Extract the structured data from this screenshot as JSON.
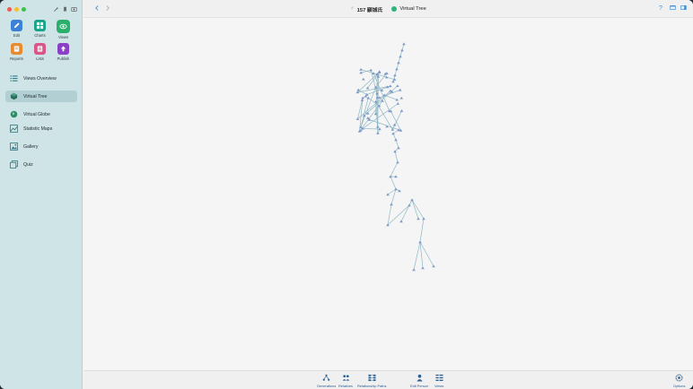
{
  "window": {
    "breadcrumb": {
      "person": "157 颛城氏",
      "view": "Virtual Tree"
    }
  },
  "sidebar": {
    "tools": [
      {
        "name": "edit",
        "label": "Edit",
        "color": "#3b82d6",
        "icon": "pencil-icon"
      },
      {
        "name": "charts",
        "label": "Charts",
        "color": "#17a38a",
        "icon": "charts-icon"
      },
      {
        "name": "views",
        "label": "Views",
        "color": "#2bb06c",
        "icon": "eye-icon",
        "selected": true
      },
      {
        "name": "reports",
        "label": "Reports",
        "color": "#e98a2e",
        "icon": "reports-icon"
      },
      {
        "name": "lists",
        "label": "Lists",
        "color": "#d9558a",
        "icon": "lists-icon"
      },
      {
        "name": "publish",
        "label": "Publish",
        "color": "#8a3fc6",
        "icon": "publish-icon"
      }
    ],
    "nav": [
      {
        "name": "views-overview",
        "label": "Views Overview",
        "icon": "list-icon",
        "active": false
      },
      {
        "name": "virtual-tree",
        "label": "Virtual Tree",
        "icon": "tree-cube-icon",
        "active": true
      },
      {
        "name": "virtual-globe",
        "label": "Virtual Globe",
        "icon": "globe-icon",
        "active": false
      },
      {
        "name": "statistic-maps",
        "label": "Statistic Maps",
        "icon": "map-icon",
        "active": false
      },
      {
        "name": "gallery",
        "label": "Gallery",
        "icon": "gallery-icon",
        "active": false
      },
      {
        "name": "quiz",
        "label": "Quiz",
        "icon": "quiz-icon",
        "active": false
      }
    ]
  },
  "bottombar": {
    "items": [
      {
        "name": "generations",
        "label": "Generations",
        "icon": "generations-icon"
      },
      {
        "name": "relatives",
        "label": "Relatives",
        "icon": "relatives-icon"
      },
      {
        "name": "relationship-paths",
        "label": "Relationship Paths",
        "icon": "relationship-paths-icon"
      },
      {
        "name": "edit-person",
        "label": "Edit Person",
        "icon": "person-icon"
      },
      {
        "name": "views",
        "label": "Views",
        "icon": "views-icon"
      },
      {
        "name": "options",
        "label": "Options",
        "icon": "gear-icon"
      }
    ]
  },
  "colors": {
    "accent": "#2b5f91",
    "tree_node": "#7d9ac8",
    "tree_line": "#8fb8c4"
  }
}
